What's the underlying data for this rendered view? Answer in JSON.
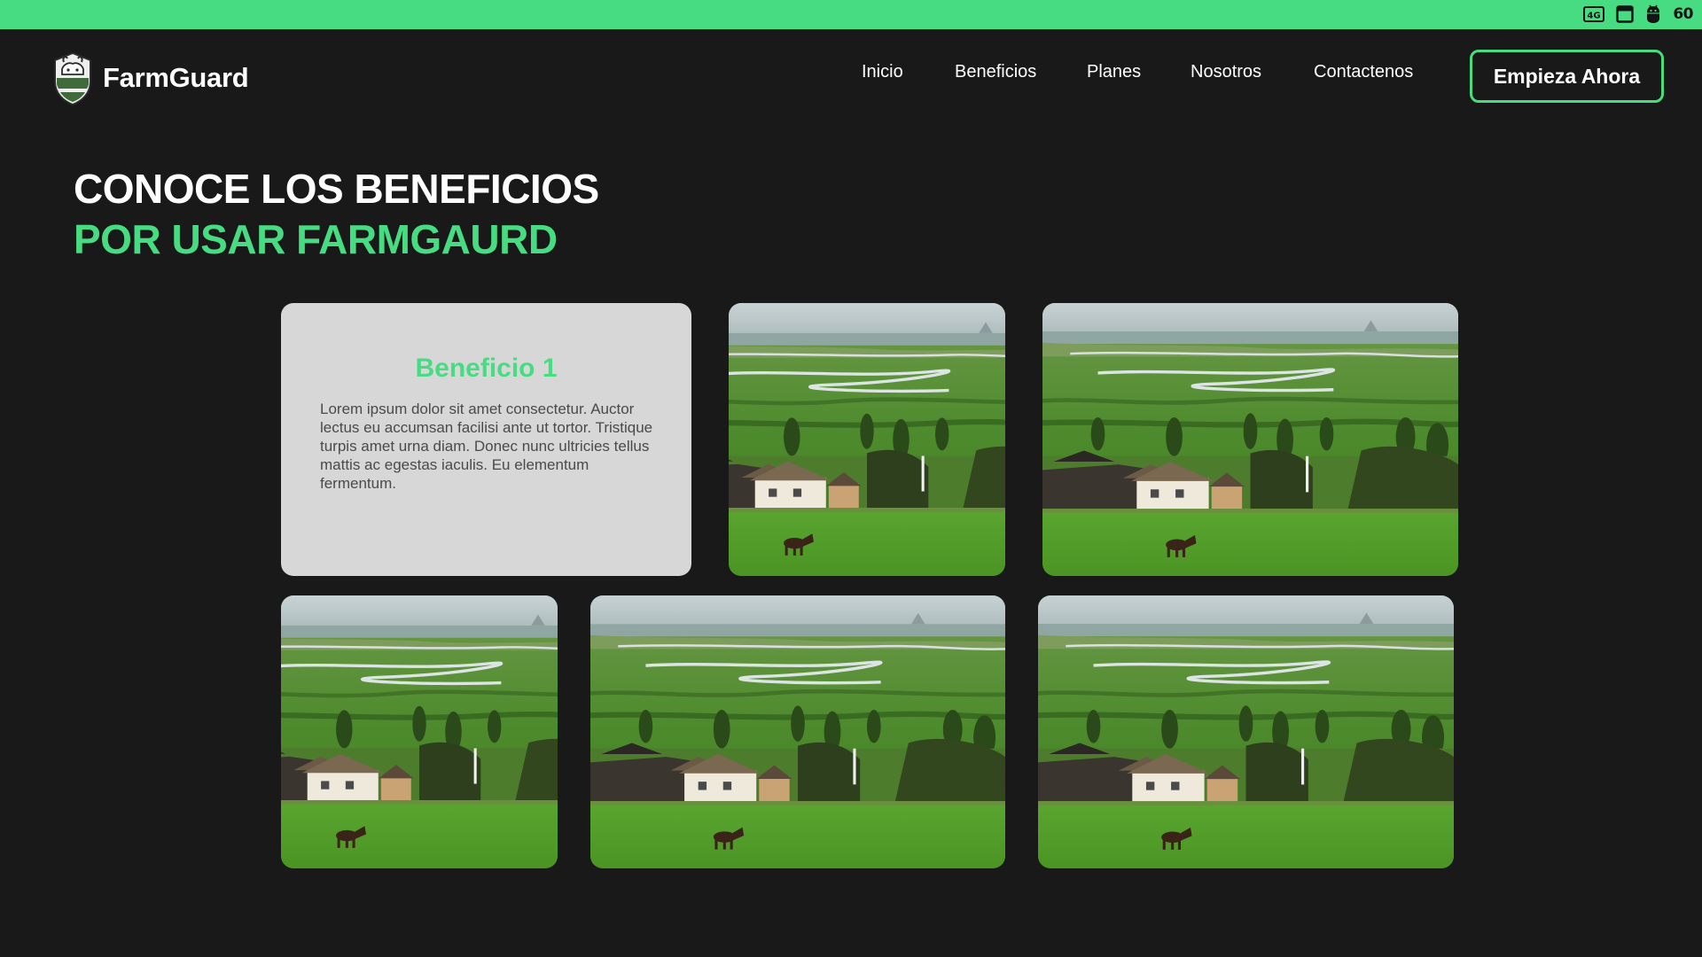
{
  "status_bar": {
    "bg_color": "#48dc82",
    "icons": [
      "network-4g-icon",
      "window-icon",
      "android-icon"
    ],
    "network_label": "4G",
    "fps": "60"
  },
  "brand": {
    "name": "FarmGuard",
    "logo_icon": "shield-crest-icon",
    "accent_color": "#48dc82"
  },
  "nav": {
    "items": [
      {
        "label": "Inicio"
      },
      {
        "label": "Beneficios"
      },
      {
        "label": "Planes"
      },
      {
        "label": "Nosotros"
      },
      {
        "label": "Contactenos"
      }
    ],
    "cta_label": "Empieza Ahora"
  },
  "section": {
    "title_line1": "CONOCE LOS BENEFICIOS",
    "title_line2": "POR USAR FARMGAURD"
  },
  "benefit_card": {
    "title": "Beneficio 1",
    "text": "Lorem ipsum dolor sit amet consectetur. Auctor lectus eu accumsan facilisi ante ut tortor. Tristique turpis amet urna diam. Donec nunc ultricies tellus mattis ac egestas iaculis. Eu elementum fermentum."
  },
  "gallery": {
    "image_subject": "farm landscape with river, cottages and grazing horse",
    "count": 5
  }
}
